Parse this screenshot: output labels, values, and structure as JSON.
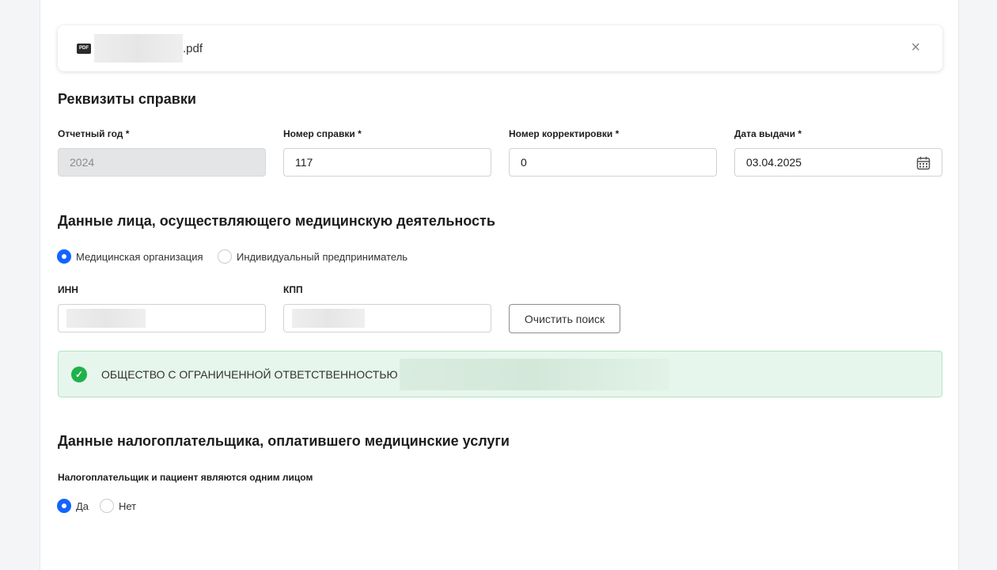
{
  "file": {
    "name_suffix": ".pdf",
    "icon": "pdf-icon"
  },
  "section1": {
    "title": "Реквизиты справки",
    "fields": [
      {
        "label": "Отчетный год *",
        "value": "2024"
      },
      {
        "label": "Номер справки *",
        "value": "117"
      },
      {
        "label": "Номер корректировки *",
        "value": "0"
      },
      {
        "label": "Дата выдачи *",
        "value": "03.04.2025"
      }
    ]
  },
  "section2": {
    "title": "Данные лица, осуществляющего медицинскую деятельность",
    "radios": [
      {
        "label": "Медицинская организация",
        "checked": true
      },
      {
        "label": "Индивидуальный предприниматель",
        "checked": false
      }
    ],
    "inn_label": "ИНН",
    "kpp_label": "КПП",
    "clear_button": "Очистить поиск",
    "result": "ОБЩЕСТВО С ОГРАНИЧЕННОЙ ОТВЕТСТВЕННОСТЬЮ"
  },
  "section3": {
    "title": "Данные налогоплательщика, оплатившего медицинские услуги",
    "question": "Налогоплательщик и пациент являются одним лицом",
    "radios": [
      {
        "label": "Да",
        "checked": true
      },
      {
        "label": "Нет",
        "checked": false
      }
    ]
  },
  "colors": {
    "accent": "#1463ff",
    "success": "#1fb24b"
  }
}
